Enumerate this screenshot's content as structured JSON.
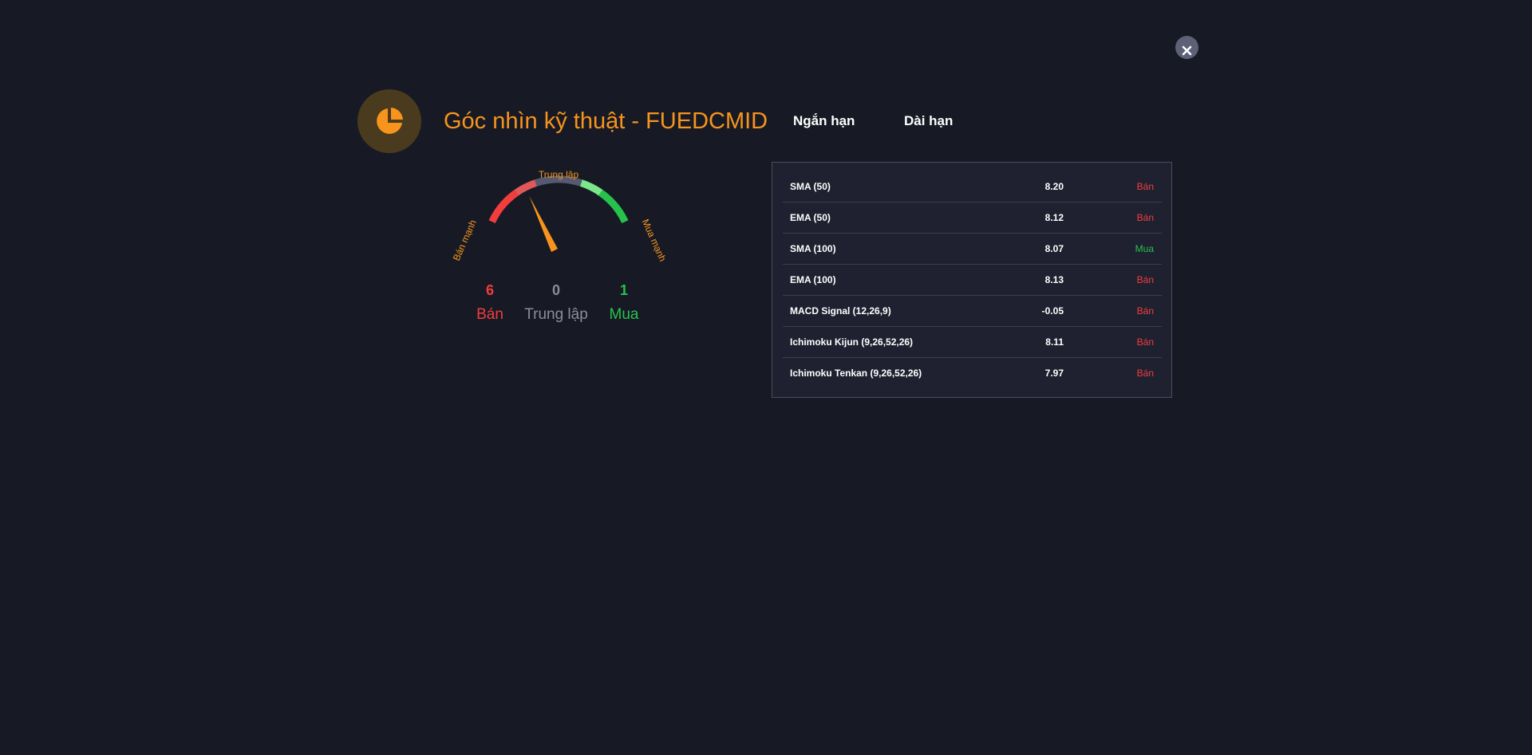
{
  "header": {
    "title": "Góc nhìn kỹ thuật - FUEDCMID",
    "tabs": [
      "Ngắn hạn",
      "Dài hạn"
    ]
  },
  "gauge": {
    "label_strong_sell": "Bán mạnh",
    "label_neutral": "Trung lập",
    "label_strong_buy": "Mua mạnh",
    "summary": {
      "sell": {
        "count": "6",
        "label": "Bán"
      },
      "neutral": {
        "count": "0",
        "label": "Trung lập"
      },
      "buy": {
        "count": "1",
        "label": "Mua"
      }
    },
    "needle_level": 0.29
  },
  "indicators": [
    {
      "name": "SMA (50)",
      "value": "8.20",
      "signal": "Bán",
      "type": "sell"
    },
    {
      "name": "EMA (50)",
      "value": "8.12",
      "signal": "Bán",
      "type": "sell"
    },
    {
      "name": "SMA (100)",
      "value": "8.07",
      "signal": "Mua",
      "type": "buy"
    },
    {
      "name": "EMA (100)",
      "value": "8.13",
      "signal": "Bán",
      "type": "sell"
    },
    {
      "name": "MACD Signal (12,26,9)",
      "value": "-0.05",
      "signal": "Bán",
      "type": "sell"
    },
    {
      "name": "Ichimoku Kijun (9,26,52,26)",
      "value": "8.11",
      "signal": "Bán",
      "type": "sell"
    },
    {
      "name": "Ichimoku Tenkan (9,26,52,26)",
      "value": "7.97",
      "signal": "Bán",
      "type": "sell"
    }
  ],
  "colors": {
    "accent": "#f7941d",
    "sell": "#f23d3d",
    "buy": "#27c24c",
    "neutral": "#8c8c97",
    "background": "#171a24"
  },
  "icons": {
    "close": "close-icon",
    "logo": "pie-chart-icon"
  }
}
